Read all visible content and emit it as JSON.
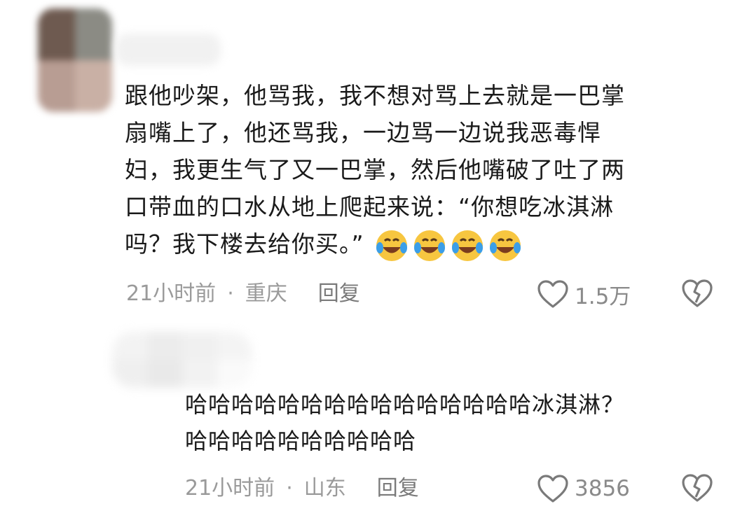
{
  "comments": [
    {
      "text": "跟他吵架，他骂我，我不想对骂上去就是一巴掌\n扇嘴上了，他还骂我，一边骂一边说我恶毒悍\n妇，我更生气了又一巴掌，然后他嘴破了吐了两\n口带血的口水从地上爬起来说：“你想吃冰淇淋\n吗？我下楼去给你买。”",
      "emoji_icon": "rolling-laughing-face-icon",
      "emoji_count": 4,
      "time": "21小时前",
      "separator": "·",
      "location": "重庆",
      "reply_label": "回复",
      "like_count": "1.5万"
    },
    {
      "text": "哈哈哈哈哈哈哈哈哈哈哈哈哈哈哈冰淇淋？\n哈哈哈哈哈哈哈哈哈哈",
      "time": "21小时前",
      "separator": "·",
      "location": "山东",
      "reply_label": "回复",
      "like_count": "3856"
    }
  ],
  "colors": {
    "text": "#1a1a1a",
    "meta": "#9a9a9a",
    "emoji_yellow": "#f7c640",
    "emoji_blue": "#3b9ee8"
  }
}
